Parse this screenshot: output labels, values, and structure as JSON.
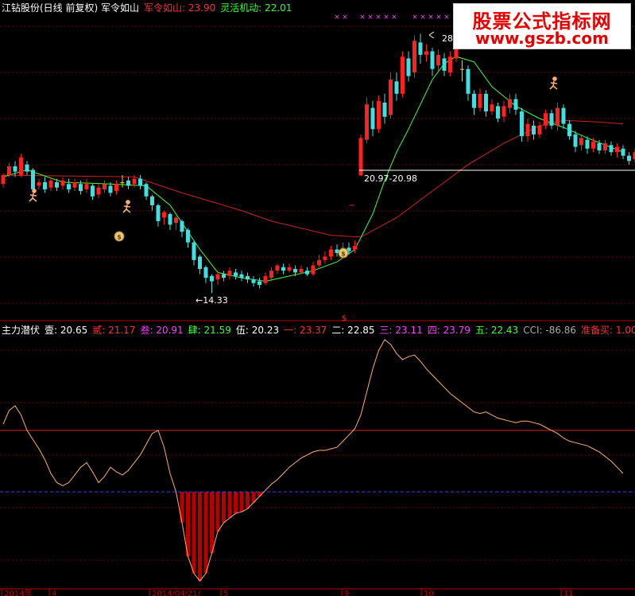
{
  "header": {
    "stock": "江钻股份(日线 前复权) 军令如山",
    "items": [
      {
        "label": "军令如山: 23.90",
        "color": "#ff3030"
      },
      {
        "label": "灵活机动: 22.01",
        "color": "#30ff30"
      }
    ]
  },
  "indicator_header": {
    "name": "主力潜伏",
    "items": [
      {
        "label": "壹: 20.65",
        "color": "#ffffff"
      },
      {
        "label": "贰: 21.17",
        "color": "#ff3030"
      },
      {
        "label": "叁: 20.91",
        "color": "#ff40ff"
      },
      {
        "label": "肆: 21.59",
        "color": "#40ff40"
      },
      {
        "label": "伍: 20.23",
        "color": "#ffffff"
      },
      {
        "label": "一: 23.37",
        "color": "#ff3030"
      },
      {
        "label": "二: 22.85",
        "color": "#ffffff"
      },
      {
        "label": "三: 23.11",
        "color": "#ff40ff"
      },
      {
        "label": "四: 23.79",
        "color": "#ff40ff"
      },
      {
        "label": "五: 22.43",
        "color": "#40ff40"
      },
      {
        "label": "CCI: -86.86",
        "color": "#aaaaaa"
      },
      {
        "label": "准备买: 1.00",
        "color": "#ff3030"
      }
    ]
  },
  "watermark": {
    "title": "股票公式指标网",
    "url": "www.gszb.com"
  },
  "chart_data": [
    {
      "type": "candlestick",
      "annotations": {
        "high": "28",
        "low": "←14.33",
        "range": "20.97-20.98",
        "dollar": "$"
      },
      "colors": {
        "up": "#ff2020",
        "down": "#40e0e0",
        "flat": "#e0e020",
        "ma_long": "#d02020",
        "ma_short": "#40ff40",
        "grid": "#7a0000",
        "divider": "#c00000"
      },
      "ylim": [
        13,
        30
      ],
      "dates": [
        "2014年",
        "4",
        "2014/04/21/",
        "5",
        "9",
        "10",
        "11"
      ],
      "candles": [
        [
          20.5,
          21.0,
          21.1,
          20.3
        ],
        [
          21.0,
          21.5,
          21.7,
          20.9
        ],
        [
          21.5,
          21.2,
          21.8,
          20.9
        ],
        [
          21.0,
          22.0,
          22.2,
          20.9
        ],
        [
          21.6,
          21.2,
          21.8,
          21.0
        ],
        [
          21.3,
          20.2,
          21.4,
          20.0
        ],
        [
          20.4,
          20.6,
          20.8,
          20.2
        ],
        [
          20.6,
          20.2,
          20.9,
          20.0
        ],
        [
          20.3,
          20.7,
          20.9,
          20.1
        ],
        [
          20.6,
          20.3,
          20.8,
          20.1
        ],
        [
          20.4,
          20.7,
          20.9,
          20.2
        ],
        [
          20.5,
          20.2,
          20.8,
          20.0
        ],
        [
          20.3,
          20.6,
          20.8,
          20.1
        ],
        [
          20.5,
          20.1,
          20.7,
          19.9
        ],
        [
          20.2,
          20.5,
          20.8,
          20.0
        ],
        [
          20.4,
          19.8,
          20.5,
          19.6
        ],
        [
          19.9,
          20.3,
          20.5,
          19.7
        ],
        [
          20.2,
          20.5,
          20.7,
          20.0
        ],
        [
          20.4,
          20.0,
          20.6,
          19.8
        ],
        [
          20.1,
          20.5,
          20.7,
          19.9
        ],
        [
          20.6,
          20.6,
          21.0,
          20.3
        ],
        [
          20.7,
          20.4,
          20.9,
          20.2
        ],
        [
          20.5,
          20.8,
          21.0,
          20.3
        ],
        [
          20.8,
          20.4,
          21.0,
          20.2
        ],
        [
          20.5,
          19.8,
          20.6,
          19.6
        ],
        [
          19.8,
          19.3,
          19.9,
          19.0
        ],
        [
          19.3,
          18.4,
          19.4,
          18.1
        ],
        [
          18.6,
          18.9,
          19.0,
          18.2
        ],
        [
          18.8,
          18.2,
          18.9,
          17.9
        ],
        [
          18.3,
          18.6,
          18.7,
          17.9
        ],
        [
          18.4,
          17.8,
          18.5,
          17.5
        ],
        [
          17.9,
          17.2,
          18.0,
          16.9
        ],
        [
          17.2,
          16.2,
          17.3,
          15.9
        ],
        [
          16.4,
          15.7,
          16.5,
          15.4
        ],
        [
          15.8,
          15.2,
          15.9,
          14.9
        ],
        [
          15.3,
          15.0,
          15.4,
          14.33
        ],
        [
          15.1,
          15.4,
          15.6,
          14.8
        ],
        [
          15.4,
          15.2,
          15.6,
          15.0
        ],
        [
          15.3,
          15.6,
          15.8,
          15.1
        ],
        [
          15.5,
          15.3,
          15.7,
          15.1
        ],
        [
          15.4,
          15.2,
          15.6,
          15.0
        ],
        [
          15.3,
          15.1,
          15.5,
          14.9
        ],
        [
          15.1,
          14.9,
          15.3,
          14.7
        ],
        [
          15.0,
          14.8,
          15.2,
          14.6
        ],
        [
          14.9,
          15.3,
          15.5,
          14.8
        ],
        [
          15.2,
          15.6,
          15.8,
          15.0
        ],
        [
          15.6,
          15.9,
          16.0,
          15.4
        ],
        [
          15.8,
          15.6,
          16.0,
          15.4
        ],
        [
          15.6,
          15.8,
          16.0,
          15.5
        ],
        [
          15.7,
          15.5,
          15.9,
          15.3
        ],
        [
          15.5,
          15.7,
          15.9,
          15.4
        ],
        [
          15.6,
          15.4,
          15.8,
          15.3
        ],
        [
          15.4,
          15.9,
          16.1,
          15.3
        ],
        [
          15.9,
          16.2,
          16.5,
          15.8
        ],
        [
          16.2,
          16.4,
          16.7,
          16.0
        ],
        [
          16.4,
          16.8,
          17.0,
          16.2
        ],
        [
          16.8,
          16.6,
          17.1,
          16.4
        ],
        [
          16.6,
          16.9,
          17.2,
          16.5
        ],
        [
          16.9,
          16.7,
          17.2,
          16.5
        ],
        [
          16.8,
          17.0,
          17.3,
          16.6
        ],
        [
          20.98,
          23.1,
          23.3,
          20.97
        ],
        [
          23.0,
          25.0,
          25.4,
          22.8
        ],
        [
          24.8,
          23.6,
          25.2,
          23.2
        ],
        [
          23.6,
          25.2,
          25.5,
          23.4
        ],
        [
          25.1,
          24.3,
          25.6,
          23.9
        ],
        [
          24.4,
          26.4,
          26.8,
          24.2
        ],
        [
          26.3,
          25.6,
          26.8,
          25.2
        ],
        [
          25.6,
          27.7,
          28.0,
          25.4
        ],
        [
          27.6,
          26.6,
          28.0,
          26.3
        ],
        [
          26.8,
          28.6,
          28.9,
          26.5
        ],
        [
          28.5,
          27.8,
          29.0,
          27.3
        ],
        [
          27.8,
          28.0,
          28.4,
          27.4
        ],
        [
          28.0,
          27.0,
          28.2,
          26.6
        ],
        [
          27.2,
          27.8,
          28.1,
          26.9
        ],
        [
          27.6,
          26.9,
          27.9,
          26.6
        ],
        [
          26.8,
          27.7,
          28.0,
          26.6
        ],
        [
          27.6,
          28.9,
          29.0,
          27.4
        ],
        [
          27.0,
          27.0,
          27.5,
          26.3
        ],
        [
          27.0,
          25.6,
          27.2,
          25.2
        ],
        [
          25.6,
          24.8,
          25.8,
          24.4
        ],
        [
          24.8,
          25.6,
          25.9,
          24.6
        ],
        [
          25.6,
          24.6,
          25.8,
          24.3
        ],
        [
          24.6,
          25.0,
          25.3,
          24.4
        ],
        [
          24.9,
          24.2,
          25.1,
          24.0
        ],
        [
          24.3,
          24.9,
          25.2,
          24.0
        ],
        [
          24.8,
          25.3,
          25.6,
          24.5
        ],
        [
          25.3,
          24.7,
          25.6,
          24.4
        ],
        [
          24.6,
          23.2,
          24.8,
          22.9
        ],
        [
          23.2,
          23.9,
          24.2,
          22.9
        ],
        [
          23.8,
          23.3,
          24.1,
          23.0
        ],
        [
          23.3,
          23.8,
          24.0,
          23.1
        ],
        [
          23.8,
          24.5,
          24.7,
          23.6
        ],
        [
          24.5,
          23.8,
          24.7,
          23.6
        ],
        [
          23.8,
          24.8,
          25.1,
          23.5
        ],
        [
          24.8,
          23.9,
          25.0,
          23.6
        ],
        [
          23.9,
          23.2,
          24.1,
          23.0
        ],
        [
          23.3,
          22.6,
          23.5,
          22.3
        ],
        [
          22.7,
          23.1,
          23.3,
          22.4
        ],
        [
          23.0,
          22.5,
          23.2,
          22.2
        ],
        [
          22.5,
          22.9,
          23.1,
          22.3
        ],
        [
          22.8,
          22.4,
          23.0,
          22.2
        ],
        [
          22.4,
          22.8,
          23.0,
          22.2
        ],
        [
          22.7,
          22.3,
          22.9,
          22.1
        ],
        [
          22.3,
          22.6,
          22.8,
          22.0
        ],
        [
          22.5,
          22.1,
          22.7,
          21.9
        ],
        [
          22.1,
          21.8,
          22.3,
          21.6
        ],
        [
          21.9,
          22.3,
          22.5,
          21.7
        ],
        [
          22.2,
          21.6,
          22.4,
          21.4
        ],
        [
          21.6,
          22.6,
          22.8,
          21.5
        ]
      ],
      "ma_long": [
        [
          0,
          21.0
        ],
        [
          22,
          20.9
        ],
        [
          30,
          20.0
        ],
        [
          40,
          19.0
        ],
        [
          45,
          18.4
        ],
        [
          55,
          17.6
        ],
        [
          60,
          17.5
        ],
        [
          66,
          18.6
        ],
        [
          72,
          20.1
        ],
        [
          78,
          21.6
        ],
        [
          84,
          22.8
        ],
        [
          90,
          23.8
        ],
        [
          94,
          24.1
        ],
        [
          100,
          24.0
        ],
        [
          104,
          23.9
        ]
      ],
      "ma_short": [
        [
          0,
          20.9
        ],
        [
          4,
          21.3
        ],
        [
          10,
          20.6
        ],
        [
          18,
          20.5
        ],
        [
          24,
          20.4
        ],
        [
          28,
          19.3
        ],
        [
          33,
          16.8
        ],
        [
          36,
          15.5
        ],
        [
          40,
          15.2
        ],
        [
          44,
          15.0
        ],
        [
          48,
          15.3
        ],
        [
          52,
          15.6
        ],
        [
          56,
          16.1
        ],
        [
          59,
          16.8
        ],
        [
          62,
          18.8
        ],
        [
          64,
          20.7
        ],
        [
          66,
          22.3
        ],
        [
          68,
          23.6
        ],
        [
          70,
          25.0
        ],
        [
          72,
          26.4
        ],
        [
          74,
          27.3
        ],
        [
          76,
          27.7
        ],
        [
          79,
          27.4
        ],
        [
          82,
          26.0
        ],
        [
          86,
          24.9
        ],
        [
          90,
          24.2
        ],
        [
          94,
          23.7
        ],
        [
          98,
          23.1
        ],
        [
          104,
          22.3
        ]
      ]
    },
    {
      "type": "line",
      "name": "主力潜伏",
      "ylim": [
        -80,
        80
      ],
      "levels": {
        "red": 20,
        "blue": -20
      },
      "values": [
        24,
        33,
        36,
        30,
        20,
        14,
        8,
        1,
        -8,
        -14,
        -16,
        -14,
        -9,
        -4,
        -1,
        -7,
        -14,
        -10,
        -4,
        -7,
        -9,
        -6,
        -1,
        4,
        11,
        18,
        20,
        9,
        -8,
        -20,
        -40,
        -62,
        -73,
        -78,
        -73,
        -60,
        -46,
        -40,
        -37,
        -34,
        -33,
        -31,
        -27,
        -23,
        -19,
        -15,
        -12,
        -8,
        -4,
        -1,
        2,
        4,
        6,
        7,
        7,
        8,
        9,
        13,
        17,
        21,
        30,
        45,
        60,
        72,
        79,
        76,
        70,
        66,
        68,
        69,
        65,
        60,
        56,
        52,
        48,
        44,
        41,
        38,
        35,
        32,
        31,
        32,
        30,
        28,
        27,
        26,
        25,
        26,
        26,
        25,
        24,
        22,
        20,
        18,
        15,
        13,
        12,
        11,
        10,
        8,
        6,
        3,
        0,
        -4,
        -8
      ]
    }
  ]
}
